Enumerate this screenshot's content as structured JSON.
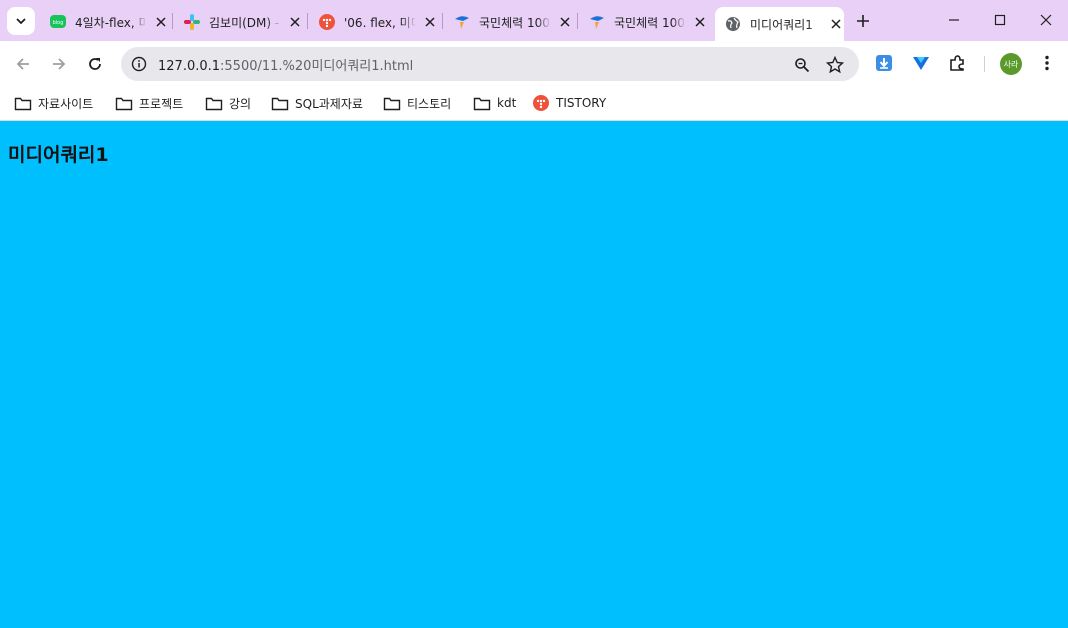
{
  "tabs": [
    {
      "label": "4일차-flex, 미",
      "favicon": "blog-icon"
    },
    {
      "label": "김보미(DM) - ",
      "favicon": "slack-icon"
    },
    {
      "label": "'06. flex, 미디",
      "favicon": "tistory-icon"
    },
    {
      "label": "국민체력 100",
      "favicon": "fitness-icon"
    },
    {
      "label": "국민체력 100",
      "favicon": "fitness-icon"
    },
    {
      "label": "미디어쿼리1",
      "favicon": "globe-icon",
      "active": true
    }
  ],
  "address": {
    "host": "127.0.0.1",
    "rest": ":5500/11.%20미디어쿼리1.html"
  },
  "profile": {
    "initials": "사라"
  },
  "bookmarks": [
    {
      "label": "자료사이트",
      "icon": "folder-icon"
    },
    {
      "label": "프로젝트",
      "icon": "folder-icon"
    },
    {
      "label": "강의",
      "icon": "folder-icon"
    },
    {
      "label": "SQL과제자료",
      "icon": "folder-icon"
    },
    {
      "label": "티스토리",
      "icon": "folder-icon"
    },
    {
      "label": "kdt",
      "icon": "folder-icon"
    },
    {
      "label": "TISTORY",
      "icon": "tistory-icon"
    }
  ],
  "page": {
    "heading": "미디어쿼리1"
  },
  "colors": {
    "tabstrip": "#e9d0f7",
    "page_background": "#00bfff"
  }
}
